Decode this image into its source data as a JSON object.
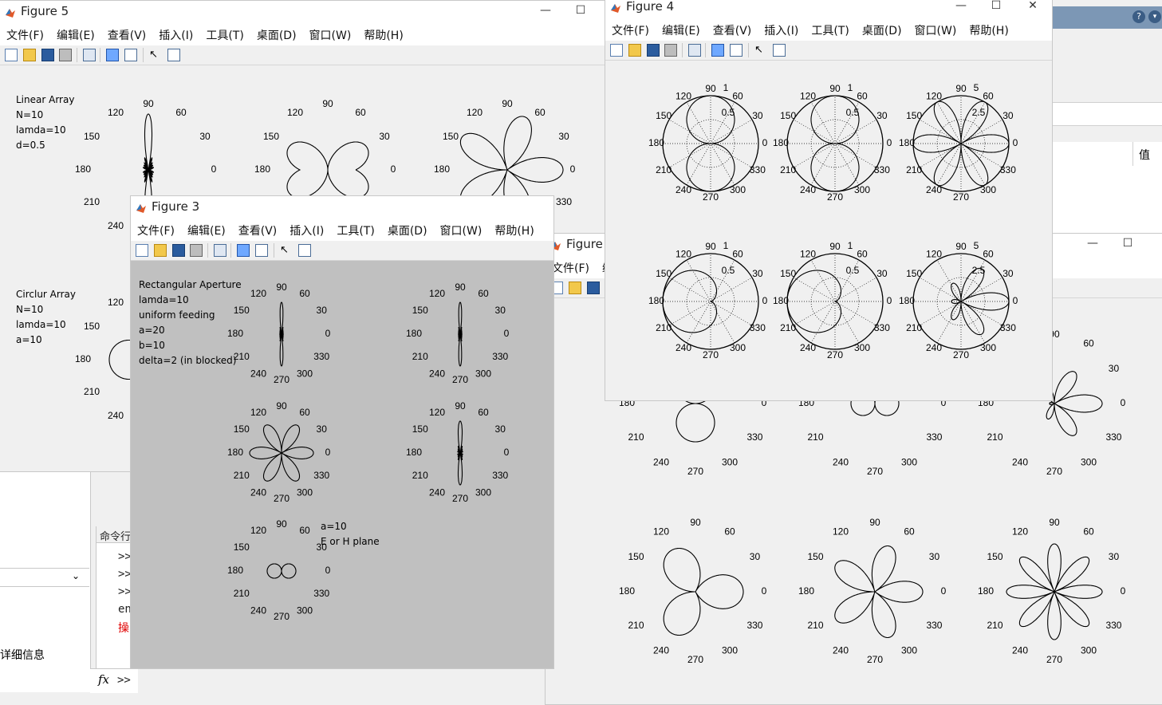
{
  "menus": [
    "文件(F)",
    "编辑(E)",
    "查看(V)",
    "插入(I)",
    "工具(T)",
    "桌面(D)",
    "窗口(W)",
    "帮助(H)"
  ],
  "figure5": {
    "title": "Figure 5",
    "notes_linear": [
      "Linear Array",
      "N=10",
      "lamda=10",
      "d=0.5"
    ],
    "notes_circular": [
      "Circlur Array",
      "N=10",
      "lamda=10",
      "a=10"
    ]
  },
  "figure3": {
    "title": "Figure 3",
    "notes": [
      "Rectangular Aperture",
      "lamda=10",
      "uniform feeding",
      "a=20",
      "b=10",
      "delta=2 (in blocked)"
    ],
    "notes2": [
      "a=10",
      "E or H plane"
    ]
  },
  "figure4": {
    "title": "Figure 4",
    "radial_labels_small": [
      "1",
      "0.5"
    ],
    "radial_labels_large": [
      "5",
      "2.5"
    ]
  },
  "figure_partial": {
    "title": "Figure"
  },
  "polar_angle_labels": [
    "90",
    "60",
    "30",
    "0",
    "330",
    "300",
    "270",
    "240",
    "210",
    "180",
    "150",
    "120"
  ],
  "matlab": {
    "right_panel_value_header": "值",
    "command_window_label": "命令行",
    "prompts": [
      ">>",
      ">>",
      ">>"
    ],
    "line_en": "en",
    "line_error": "操",
    "details_text": "详细信息",
    "fx_prompt": ">>",
    "fx_symbol": "fx"
  },
  "colors": {
    "plot_gray": "#c0c0c0",
    "window_bg": "#f0f0f0",
    "error_red": "#e00000"
  }
}
